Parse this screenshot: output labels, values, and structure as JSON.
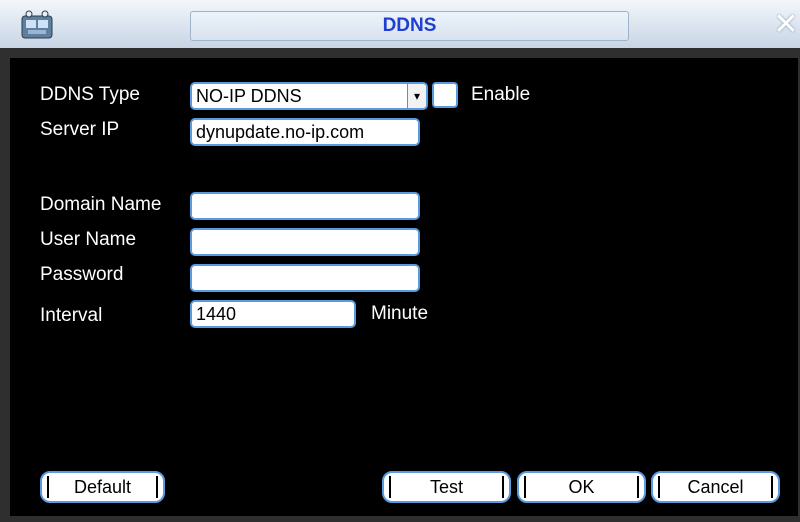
{
  "window": {
    "title": "DDNS",
    "close_glyph": "✕",
    "app_icon": "network-device-icon"
  },
  "form": {
    "ddns_type": {
      "label": "DDNS Type",
      "value": "NO-IP DDNS",
      "arrow": "▾"
    },
    "enable": {
      "label": "Enable",
      "checked": false
    },
    "server_ip": {
      "label": "Server IP",
      "value": "dynupdate.no-ip.com"
    },
    "domain_name": {
      "label": "Domain Name",
      "value": ""
    },
    "user_name": {
      "label": "User Name",
      "value": ""
    },
    "password": {
      "label": "Password",
      "value": ""
    },
    "interval": {
      "label": "Interval",
      "value": "1440",
      "unit": "Minute"
    }
  },
  "buttons": {
    "default": "Default",
    "test": "Test",
    "ok": "OK",
    "cancel": "Cancel"
  },
  "colors": {
    "title_text": "#1e3fd0",
    "field_border": "#5a9be0",
    "background": "#000000"
  }
}
